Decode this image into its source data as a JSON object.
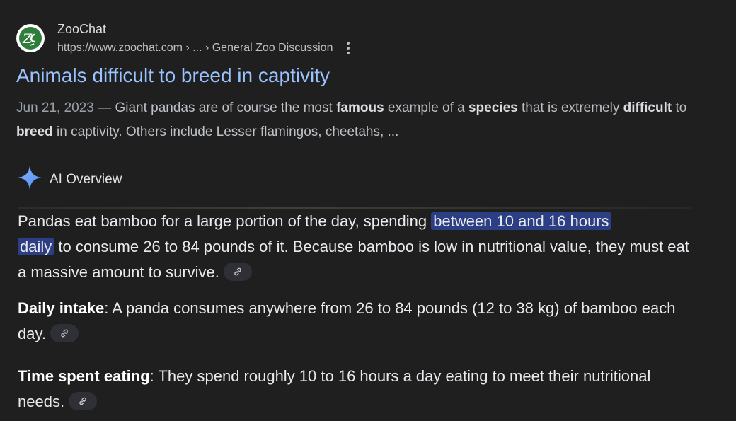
{
  "result": {
    "site_name": "ZooChat",
    "url": "https://www.zoochat.com › ... › General Zoo Discussion",
    "title": "Animals difficult to breed in captivity",
    "snippet": {
      "date": "Jun 21, 2023",
      "sep": " — ",
      "t1": "Giant pandas are of course the most ",
      "b1": "famous",
      "t2": " example of a ",
      "b2": "species",
      "t3": " that is extremely ",
      "b3": "difficult",
      "t4": " to ",
      "b4": "breed",
      "t5": " in captivity. Others include Lesser flamingos, cheetahs, ..."
    },
    "favicon_icon": "zoochat-logo",
    "more_icon": "more-vert-icon"
  },
  "ai_overview": {
    "label": "AI Overview",
    "icon": "sparkle-icon",
    "p1_start": "Pandas eat bamboo for a large portion of the day, spending ",
    "p1_highlight_a": "between 10 and 16 hours",
    "p1_highlight_b": "daily",
    "p1_end": " to consume 26 to 84 pounds of it. Because bamboo is low in nutritional value, they must eat a massive amount to survive.",
    "p2_bold": "Daily intake",
    "p2_text": ": A panda consumes anywhere from 26 to 84 pounds (12 to 38 kg) of bamboo each day.",
    "p3_bold": "Time spent eating",
    "p3_text": ": They spend roughly 10 to 16 hours a day eating to meet their nutritional needs.",
    "link_icon": "link-icon"
  },
  "colors": {
    "background": "#1f1f1f",
    "title_link": "#99c3ff",
    "highlight": "#2c3e84",
    "sparkle": "#6fa8ff"
  }
}
